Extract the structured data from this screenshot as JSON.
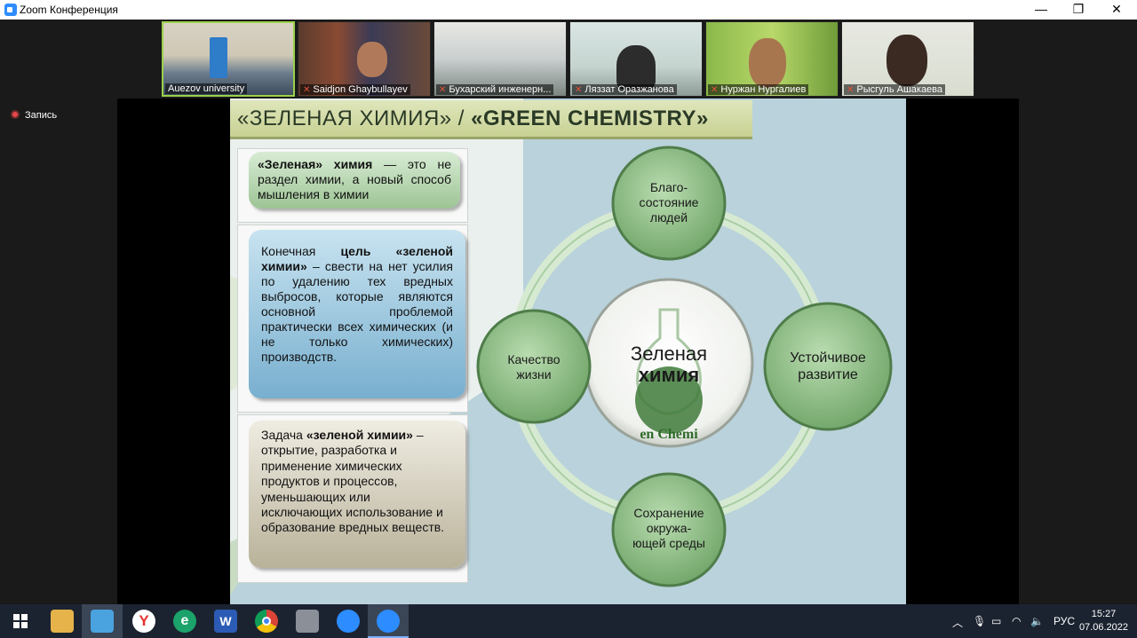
{
  "window": {
    "title": "Zoom Конференция",
    "controls": {
      "minimize": "—",
      "maximize": "❐",
      "close": "✕"
    }
  },
  "participants": [
    {
      "name": "Auezov university",
      "muted": false,
      "active": true
    },
    {
      "name": "Saidjon Ghaybullayev",
      "muted": true,
      "active": false
    },
    {
      "name": "Бухарский инженерн...",
      "muted": true,
      "active": false
    },
    {
      "name": "Ляззат Оразжанова",
      "muted": true,
      "active": false
    },
    {
      "name": "Нуржан Нургалиев",
      "muted": true,
      "active": false
    },
    {
      "name": "Рысгуль  Ашакаева",
      "muted": true,
      "active": false
    }
  ],
  "recording": {
    "label": "Запись"
  },
  "slide": {
    "title_part1": "«ЗЕЛЕНАЯ ХИМИЯ» / ",
    "title_part2": "«GREEN CHEMISTRY»",
    "box1": {
      "bold": "«Зеленая» химия",
      "text": " — это не раздел химии, а новый способ мышления в химии"
    },
    "box2": {
      "pre": "Конечная ",
      "bold": "цель «зеленой химии»",
      "text": " – свести на нет усилия по удалению тех вредных выбросов, которые являются основной проблемой практически всех химических (и не только химических) производств."
    },
    "box3": {
      "pre": "Задача ",
      "bold": "«зеленой химии»",
      "text": " – открытие, разработка и применение химических продуктов и процессов, уменьшающих или исключающих использование и образование вредных веществ."
    },
    "center": {
      "line1": "Зеленая",
      "line2": "химия",
      "logo_text": "en Chemi"
    },
    "nodes": {
      "top": "Благо-\nсостояние\nлюдей",
      "left": "Качество\nжизни",
      "right": "Устойчивое\nразвитие",
      "bottom": "Сохранение\nокружа-\nющей среды"
    }
  },
  "taskbar": {
    "language": "РУС",
    "time": "15:27",
    "date": "07.06.2022"
  },
  "colors": {
    "zoom_blue": "#2d8cff",
    "record_red": "#e4474b",
    "node_green": "#8dbf84",
    "taskbar_bg": "#1c2330"
  }
}
